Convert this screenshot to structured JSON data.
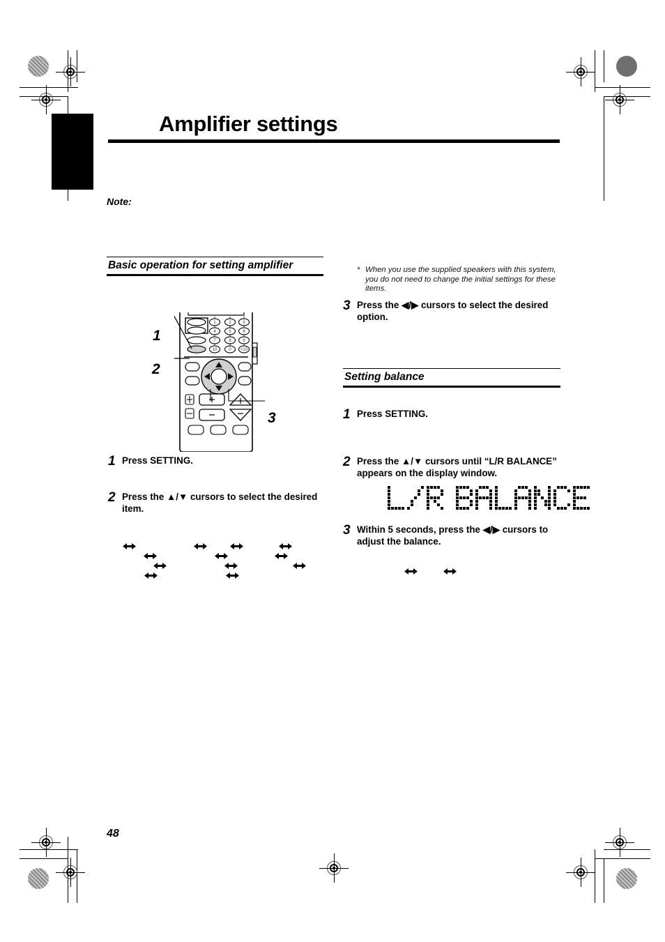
{
  "page": {
    "number": "48",
    "chapter_title": "Amplifier settings",
    "note_label": "Note:"
  },
  "left_column": {
    "section_title": "Basic operation for setting amplifier",
    "remote_callouts": [
      "1",
      "2",
      "3"
    ],
    "remote_keypad": [
      "1",
      "2",
      "3",
      "4",
      "5",
      "6",
      "7",
      "8",
      "9",
      "10",
      "0",
      "+10"
    ],
    "steps": [
      {
        "num": "1",
        "text": "Press SETTING."
      },
      {
        "num": "2",
        "text": "Press the ▲/▼ cursors to select the desired item."
      }
    ]
  },
  "right_column": {
    "footnote": {
      "marker": "*",
      "text": "When you use the supplied speakers with this system, you do not need to change the initial settings for these items."
    },
    "step3": {
      "num": "3",
      "text": "Press the ◀/▶ cursors to select the desired option."
    },
    "section_title": "Setting balance",
    "steps": [
      {
        "num": "1",
        "text": "Press SETTING."
      },
      {
        "num": "2",
        "text": "Press the ▲/▼ cursors until “L/R BALANCE” appears on the display window."
      },
      {
        "num": "3",
        "text": "Within 5 seconds, press the ◀/▶ cursors to adjust the balance."
      }
    ],
    "display_window_text": "L/R BALANCE"
  },
  "colors": {
    "ink": "#000000",
    "paper": "#ffffff",
    "registration_gray": "#6f6f6f"
  },
  "flow_arrows": {
    "left_group_count": 10,
    "right_group_count": 2,
    "glyph": "↔"
  }
}
